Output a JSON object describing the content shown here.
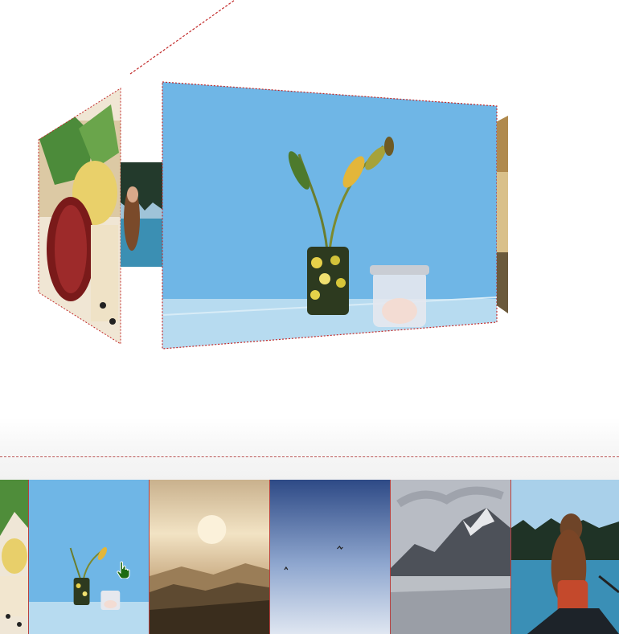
{
  "carousel": {
    "panels": [
      {
        "name": "vegetables"
      },
      {
        "name": "woman-lake"
      },
      {
        "name": "plant-vase"
      },
      {
        "name": "side-edge"
      }
    ],
    "colors": {
      "border": "#c22a2a",
      "sky": "#6fb6e6"
    }
  },
  "thumbnails": [
    {
      "name": "vegetables"
    },
    {
      "name": "plant-vase"
    },
    {
      "name": "sunset-mountains"
    },
    {
      "name": "birds-sky"
    },
    {
      "name": "misty-mountain"
    },
    {
      "name": "woman-lake"
    }
  ]
}
